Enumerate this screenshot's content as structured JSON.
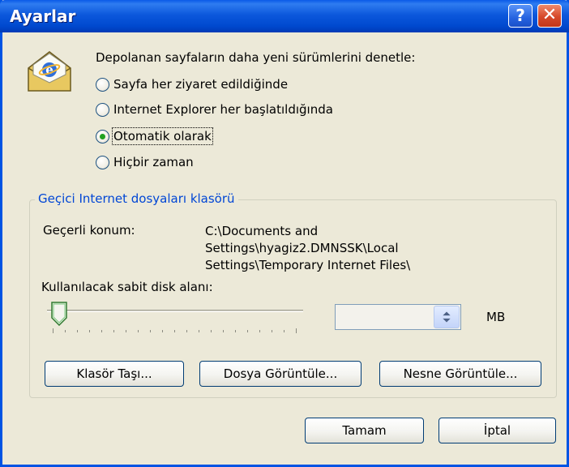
{
  "window": {
    "title": "Ayarlar",
    "help_glyph": "?",
    "close_glyph": "✕"
  },
  "check": {
    "heading": "Depolanan sayfaların daha yeni sürümlerini denetle:",
    "options": [
      {
        "label": "Sayfa her ziyaret edildiğinde",
        "selected": false
      },
      {
        "label": "Internet Explorer her başlatıldığında",
        "selected": false
      },
      {
        "label": "Otomatik olarak",
        "selected": true
      },
      {
        "label": "Hiçbir zaman",
        "selected": false
      }
    ]
  },
  "temp_folder": {
    "group_title": "Geçici Internet dosyaları klasörü",
    "location_label": "Geçerli konum:",
    "location_lines": [
      "C:\\Documents and",
      "Settings\\hyagiz2.DMNSSK\\Local",
      "Settings\\Temporary Internet Files\\"
    ],
    "disk_label": "Kullanılacak sabit disk alanı:",
    "slider_level_fraction": 0.05,
    "disk_value": "",
    "unit": "MB"
  },
  "buttons": {
    "move_folder": "Klasör Taşı...",
    "view_files": "Dosya Görüntüle...",
    "view_objects": "Nesne Görüntüle...",
    "ok": "Tamam",
    "cancel": "İptal"
  },
  "colors": {
    "titlebar": "#0054e3",
    "group_title": "#0046d5",
    "radio_dot": "#21a121",
    "close_button": "#d6492a"
  },
  "icons": {
    "app": "ie-envelope-icon",
    "help": "help-icon",
    "close": "close-icon",
    "spin": "spin-updown-icon",
    "slider": "slider-thumb"
  }
}
